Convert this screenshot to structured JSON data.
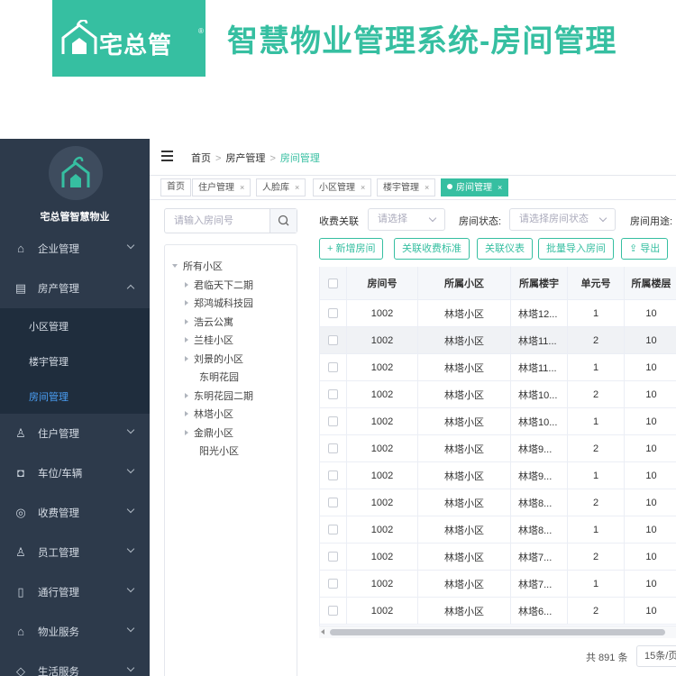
{
  "banner": {
    "logo_text": "宅总管",
    "logo_mark": "®",
    "title": "智慧物业管理系统-房间管理"
  },
  "colors": {
    "accent": "#36bfa1",
    "sidebar_bg": "#2d3a4b",
    "sidebar_sub_bg": "#1f2d3d",
    "active_link": "#4a9ff5"
  },
  "sidebar": {
    "brand": "宅总管智慧物业",
    "items": [
      {
        "label": "企业管理",
        "icon": "building-icon"
      },
      {
        "label": "房产管理",
        "icon": "house-property-icon",
        "expanded": true
      },
      {
        "label": "住户管理",
        "icon": "resident-icon"
      },
      {
        "label": "车位/车辆",
        "icon": "car-icon"
      },
      {
        "label": "收费管理",
        "icon": "fee-icon"
      },
      {
        "label": "员工管理",
        "icon": "staff-icon"
      },
      {
        "label": "通行管理",
        "icon": "access-icon"
      },
      {
        "label": "物业服务",
        "icon": "service-icon"
      },
      {
        "label": "生活服务",
        "icon": "life-service-icon"
      }
    ],
    "subitems": [
      {
        "label": "小区管理",
        "active": false
      },
      {
        "label": "楼宇管理",
        "active": false
      },
      {
        "label": "房间管理",
        "active": true
      }
    ]
  },
  "breadcrumb": {
    "home": "首页",
    "section": "房产管理",
    "current": "房间管理",
    "separator": ">"
  },
  "tags": [
    {
      "label": "首页",
      "closable": false,
      "active": false
    },
    {
      "label": "住户管理",
      "closable": true,
      "active": false
    },
    {
      "label": "人脸库",
      "closable": true,
      "active": false
    },
    {
      "label": "小区管理",
      "closable": true,
      "active": false
    },
    {
      "label": "楼宇管理",
      "closable": true,
      "active": false
    },
    {
      "label": "房间管理",
      "closable": true,
      "active": true
    }
  ],
  "tag_close": "×",
  "tree": {
    "search_placeholder": "请输入房间号",
    "root": "所有小区",
    "nodes": [
      {
        "label": "君临天下二期",
        "has_children": true
      },
      {
        "label": "郑鸿城科技园",
        "has_children": true
      },
      {
        "label": "浩云公寓",
        "has_children": true
      },
      {
        "label": "兰桂小区",
        "has_children": true
      },
      {
        "label": "刘景的小区",
        "has_children": true
      },
      {
        "label": "东明花园",
        "has_children": false
      },
      {
        "label": "东明花园二期",
        "has_children": true
      },
      {
        "label": "林塔小区",
        "has_children": true
      },
      {
        "label": "金鼎小区",
        "has_children": true
      },
      {
        "label": "阳光小区",
        "has_children": false
      }
    ]
  },
  "filters": {
    "fee_label": "收费关联",
    "fee_placeholder": "请选择",
    "status_label": "房间状态:",
    "status_placeholder": "请选择房间状态",
    "usage_label": "房间用途:"
  },
  "actions": {
    "add": "+ 新增房间",
    "link_fee": "关联收费标准",
    "link_meter": "关联仪表",
    "batch_import": "批量导入房间",
    "export": "导出"
  },
  "table": {
    "columns": [
      "房间号",
      "所属小区",
      "所属楼宇",
      "单元号",
      "所属楼层"
    ],
    "rows": [
      [
        "1002",
        "林塔小区",
        "林塔12...",
        "1",
        "10"
      ],
      [
        "1002",
        "林塔小区",
        "林塔11...",
        "2",
        "10"
      ],
      [
        "1002",
        "林塔小区",
        "林塔11...",
        "1",
        "10"
      ],
      [
        "1002",
        "林塔小区",
        "林塔10...",
        "2",
        "10"
      ],
      [
        "1002",
        "林塔小区",
        "林塔10...",
        "1",
        "10"
      ],
      [
        "1002",
        "林塔小区",
        "林塔9...",
        "2",
        "10"
      ],
      [
        "1002",
        "林塔小区",
        "林塔9...",
        "1",
        "10"
      ],
      [
        "1002",
        "林塔小区",
        "林塔8...",
        "2",
        "10"
      ],
      [
        "1002",
        "林塔小区",
        "林塔8...",
        "1",
        "10"
      ],
      [
        "1002",
        "林塔小区",
        "林塔7...",
        "2",
        "10"
      ],
      [
        "1002",
        "林塔小区",
        "林塔7...",
        "1",
        "10"
      ],
      [
        "1002",
        "林塔小区",
        "林塔6...",
        "2",
        "10"
      ]
    ]
  },
  "pager": {
    "total": "共 891 条",
    "page_size": "15条/页"
  }
}
